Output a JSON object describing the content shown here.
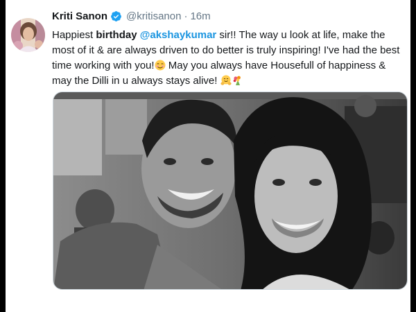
{
  "author": {
    "name": "Kriti Sanon",
    "handle": "@kritisanon",
    "separator": "·",
    "time": "16m"
  },
  "tweet": {
    "seg1": "Happiest ",
    "seg2": "birthday",
    "seg3": " ",
    "mention": "@akshaykumar",
    "seg4": " sir!! The way u look at life, make the most of it & are always driven to do better is truly inspiring! I've had the best time working with you!",
    "seg5": " May you always have Housefull of happiness & may the Dilli in u always stays alive! ",
    "emojis": [
      "smiling-face-emoji",
      "hugging-face-emoji",
      "bouquet-emoji"
    ]
  },
  "colors": {
    "mention": "#1b95e0",
    "verified": "#1da1f2",
    "text": "#14171a",
    "muted": "#657786"
  }
}
